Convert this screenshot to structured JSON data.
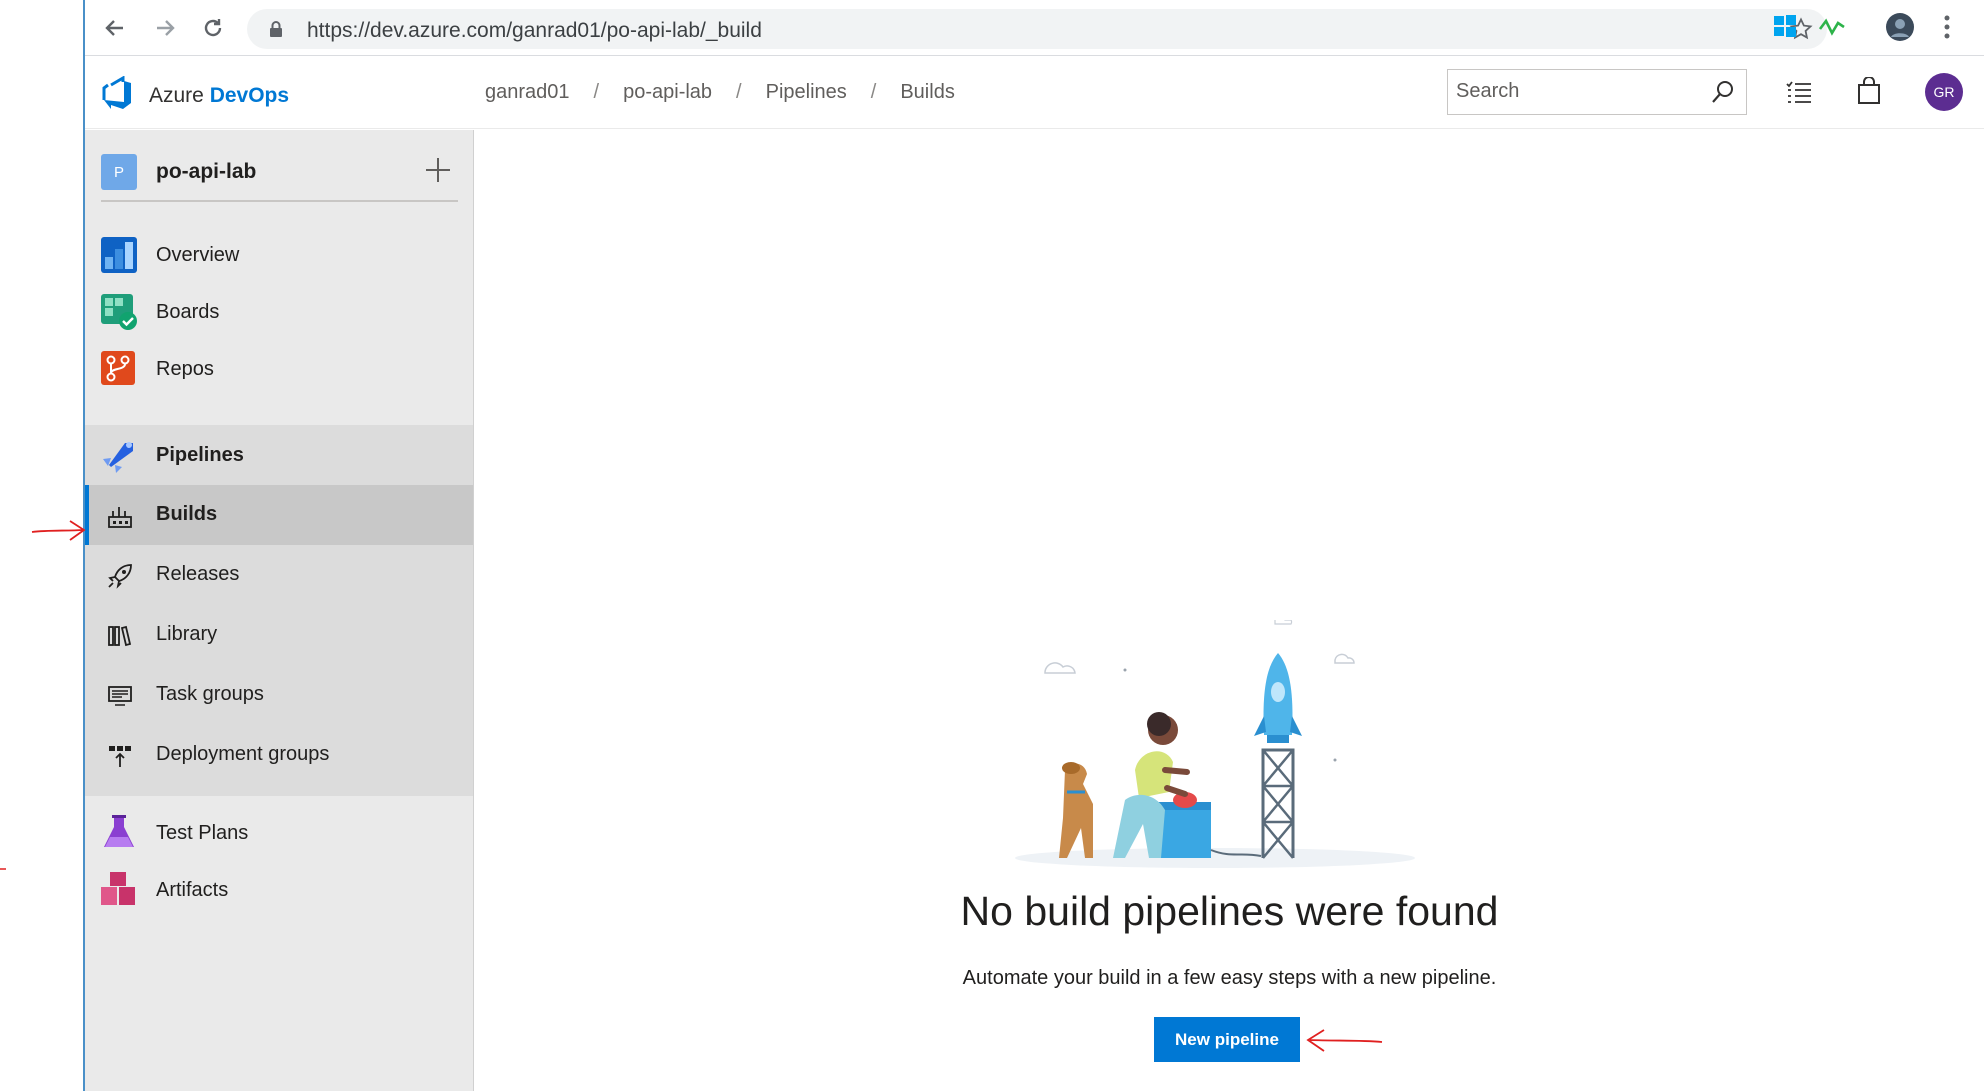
{
  "browser": {
    "url": "https://dev.azure.com/ganrad01/po-api-lab/_build"
  },
  "header": {
    "brand_prefix": "Azure ",
    "brand_emphasis": "DevOps",
    "breadcrumbs": [
      "ganrad01",
      "po-api-lab",
      "Pipelines",
      "Builds"
    ],
    "breadcrumb_separator": "/",
    "search_placeholder": "Search",
    "avatar_initials": "GR"
  },
  "sidebar": {
    "project_initial": "P",
    "project_name": "po-api-lab",
    "items": [
      {
        "label": "Overview",
        "icon": "overview-icon"
      },
      {
        "label": "Boards",
        "icon": "boards-icon"
      },
      {
        "label": "Repos",
        "icon": "repos-icon"
      },
      {
        "label": "Pipelines",
        "icon": "pipelines-icon"
      },
      {
        "label": "Test Plans",
        "icon": "test-plans-icon"
      },
      {
        "label": "Artifacts",
        "icon": "artifacts-icon"
      }
    ],
    "pipeline_subitems": [
      {
        "label": "Builds",
        "icon": "builds-icon",
        "selected": true
      },
      {
        "label": "Releases",
        "icon": "releases-icon"
      },
      {
        "label": "Library",
        "icon": "library-icon"
      },
      {
        "label": "Task groups",
        "icon": "task-groups-icon"
      },
      {
        "label": "Deployment groups",
        "icon": "deployment-groups-icon"
      }
    ]
  },
  "main": {
    "empty_title": "No build pipelines were found",
    "empty_description": "Automate your build in a few easy steps with a new pipeline.",
    "new_pipeline_label": "New pipeline"
  },
  "colors": {
    "accent": "#0078d4",
    "annotation": "#e02020",
    "sidebar_bg": "#eaeaea"
  }
}
